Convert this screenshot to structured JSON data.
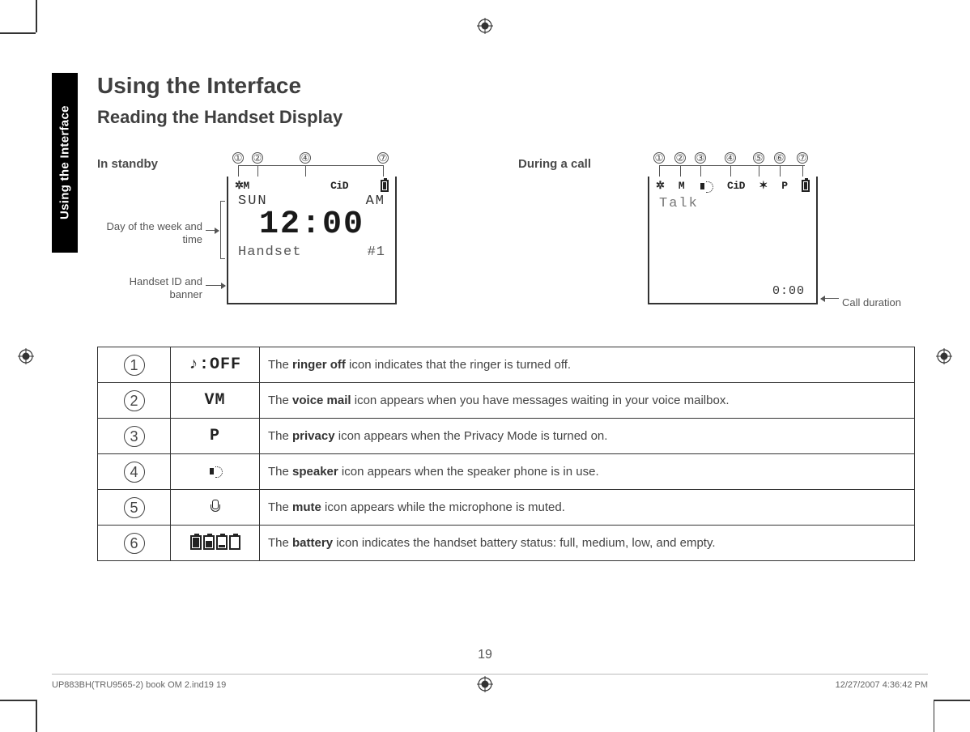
{
  "sidetab": "Using the Interface",
  "title": "Using the Interface",
  "subtitle": "Reading the Handset Display",
  "standby": {
    "label": "In standby",
    "callout_numbers": [
      "①",
      "②",
      "④",
      "⑦"
    ],
    "annot_daytime": "Day of the week and time",
    "annot_handsetid": "Handset ID and banner",
    "icons_row": {
      "bell": "✲",
      "vm": "M",
      "cid": "CiD",
      "batt": ""
    },
    "day": "SUN",
    "ampm": "AM",
    "time": "12:00",
    "banner_label": "Handset",
    "banner_id": "#1"
  },
  "during_call": {
    "label": "During a call",
    "callout_numbers": [
      "①",
      "②",
      "③",
      "④",
      "⑤",
      "⑥",
      "⑦"
    ],
    "icons_row": {
      "bell": "✲",
      "vm": "M",
      "spk": "",
      "cid": "CiD",
      "mic": "✶",
      "p": "P",
      "batt": ""
    },
    "talk": "Talk",
    "duration": "0:00",
    "annot_duration": "Call duration"
  },
  "legend": [
    {
      "num": "1",
      "icon_text": "♪:OFF",
      "desc_bold": "ringer off",
      "desc_before": "The ",
      "desc_after": " icon indicates that the ringer is turned off."
    },
    {
      "num": "2",
      "icon_text": "VM",
      "desc_bold": "voice mail",
      "desc_before": "The ",
      "desc_after": " icon appears when you have messages waiting in your voice mailbox."
    },
    {
      "num": "3",
      "icon_text": "P",
      "desc_bold": "privacy",
      "desc_before": "The ",
      "desc_after": " icon appears when the Privacy Mode is turned on."
    },
    {
      "num": "4",
      "icon_text": "",
      "desc_bold": "speaker",
      "desc_before": "The ",
      "desc_after": " icon appears when the speaker phone is in use."
    },
    {
      "num": "5",
      "icon_text": "",
      "desc_bold": "mute",
      "desc_before": "The ",
      "desc_after": " icon appears while the microphone is muted."
    },
    {
      "num": "6",
      "icon_text": "",
      "desc_bold": "battery",
      "desc_before": "The ",
      "desc_after": " icon indicates the handset battery status: full, medium, low, and empty."
    }
  ],
  "page_number": "19",
  "footer_left": "UP883BH(TRU9565-2) book OM 2.ind19   19",
  "footer_right": "12/27/2007   4:36:42 PM"
}
